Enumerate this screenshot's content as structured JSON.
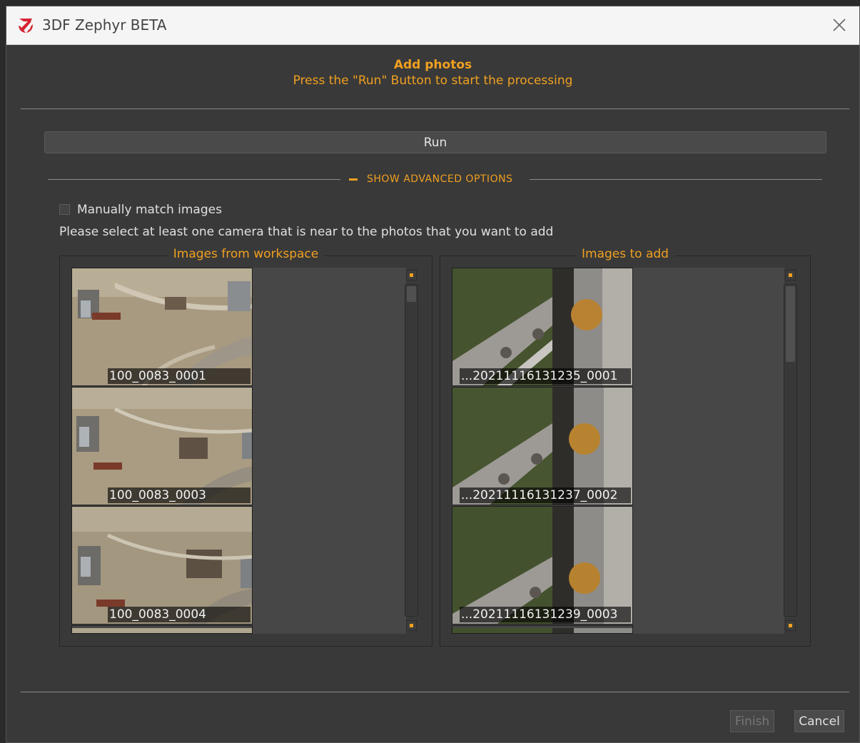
{
  "window": {
    "title": "3DF Zephyr BETA",
    "close_icon": "close-icon"
  },
  "header": {
    "title": "Add photos",
    "subtitle": "Press the \"Run\" Button to start the processing"
  },
  "run_button": {
    "label": "Run"
  },
  "advanced": {
    "label": "SHOW ADVANCED OPTIONS",
    "icon": "minus-icon"
  },
  "manual_match": {
    "label": "Manually match images",
    "checked": false
  },
  "instruction": "Please select at least one camera that is near to the photos that you want to add",
  "workspace": {
    "title": "Images from workspace",
    "images": [
      {
        "label": "100_0083_0001"
      },
      {
        "label": "100_0083_0003"
      },
      {
        "label": "100_0083_0004"
      }
    ]
  },
  "to_add": {
    "title": "Images to add",
    "images": [
      {
        "label": "...20211116131235_0001"
      },
      {
        "label": "...20211116131237_0002"
      },
      {
        "label": "...20211116131239_0003"
      }
    ]
  },
  "footer": {
    "finish_label": "Finish",
    "cancel_label": "Cancel"
  },
  "colors": {
    "accent": "#f0a020",
    "background": "#393939",
    "logo_red": "#d62330"
  }
}
